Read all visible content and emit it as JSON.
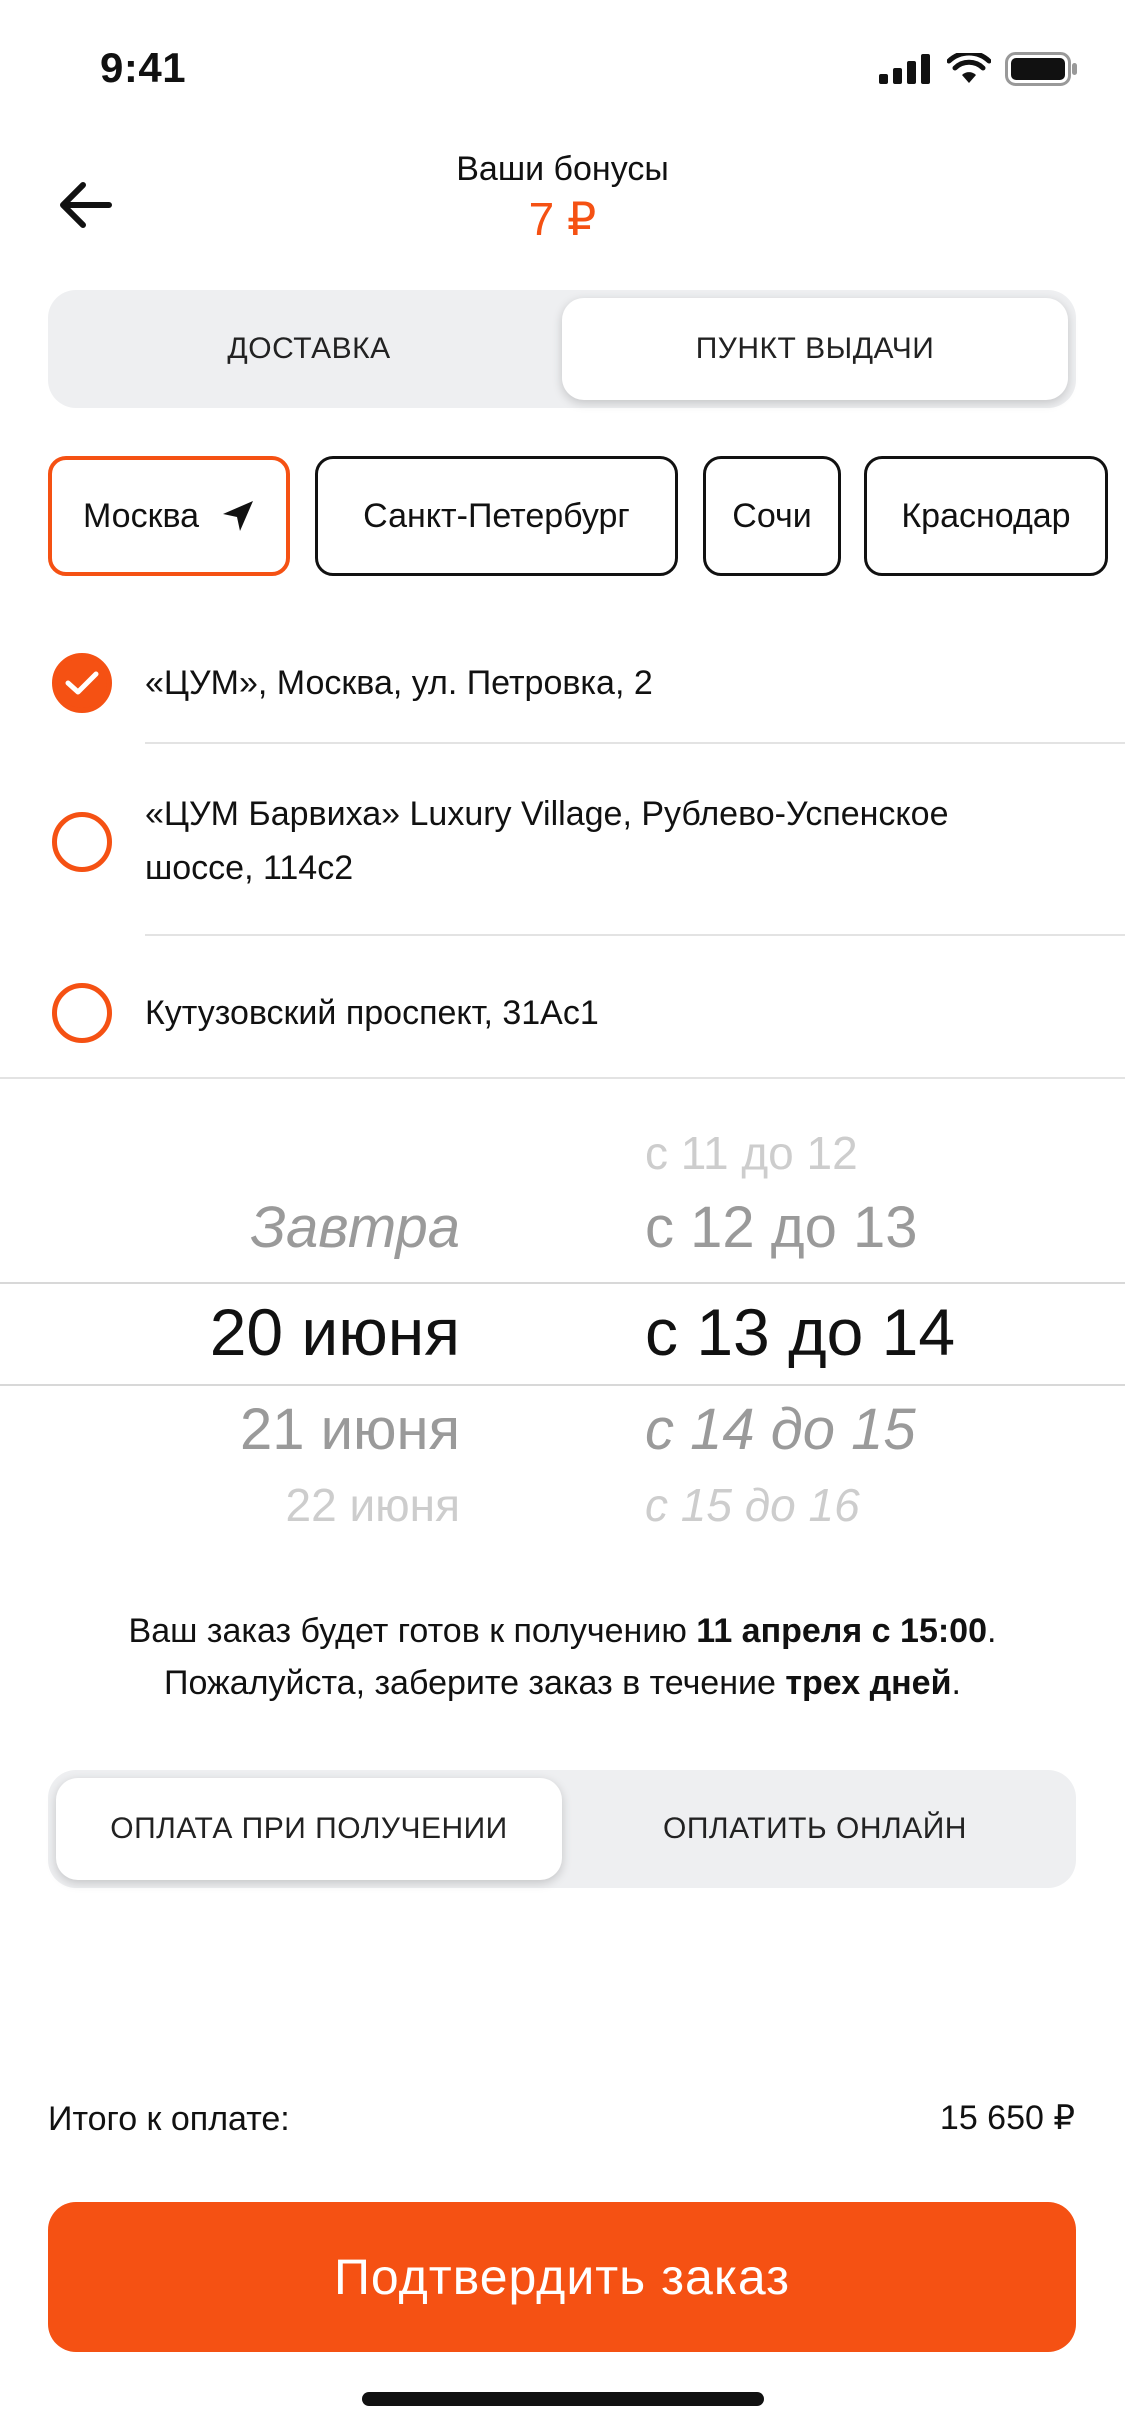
{
  "status_bar": {
    "time": "9:41"
  },
  "header": {
    "title": "Ваши бонусы",
    "bonus": "7 ₽"
  },
  "delivery_toggle": {
    "options": [
      "ДОСТАВКА",
      "ПУНКТ ВЫДАЧИ"
    ],
    "selected": "ПУНКТ ВЫДАЧИ"
  },
  "cities": {
    "items": [
      "Москва",
      "Санкт-Петербург",
      "Сочи",
      "Краснодар"
    ],
    "selected": "Москва"
  },
  "addresses": {
    "items": [
      {
        "text": "«ЦУМ», Москва, ул. Петровка, 2",
        "checked": true
      },
      {
        "text": "«ЦУМ Барвиха» Luxury Village, Рублево-Успенское шоссе, 114с2",
        "checked": false
      },
      {
        "text": "Кутузовский проспект, 31Ас1",
        "checked": false
      }
    ]
  },
  "picker": {
    "dates": [
      "Завтра",
      "20 июня",
      "21 июня",
      "22 июня"
    ],
    "times": [
      "с 11 до 12",
      "с 12 до 13",
      "с 13 до 14",
      "с 14 до 15",
      "с 15 до 16"
    ],
    "selected_date": "20 июня",
    "selected_time": "с 13 до 14"
  },
  "ready_note": {
    "line1_prefix": "Ваш заказ будет готов к получению ",
    "line1_bold": "11 апреля с 15:00",
    "line1_suffix": ".",
    "line2_prefix": "Пожалуйста, заберите заказ в течение ",
    "line2_bold": "трех дней",
    "line2_suffix": "."
  },
  "payment_toggle": {
    "options": [
      "ОПЛАТА ПРИ ПОЛУЧЕНИИ",
      "ОПЛАТИТЬ ОНЛАЙН"
    ],
    "selected": "ОПЛАТА ПРИ ПОЛУЧЕНИИ"
  },
  "total": {
    "label": "Итого к оплате:",
    "value": "15 650 ₽"
  },
  "confirm_button": {
    "label": "Подтвердить заказ"
  },
  "colors": {
    "accent": "#f55113",
    "segment_bg": "#eeeff1",
    "text": "#111111"
  },
  "icons": [
    "back-arrow-icon",
    "location-arrow-icon",
    "check-icon",
    "signal-icon",
    "wifi-icon",
    "battery-icon"
  ]
}
